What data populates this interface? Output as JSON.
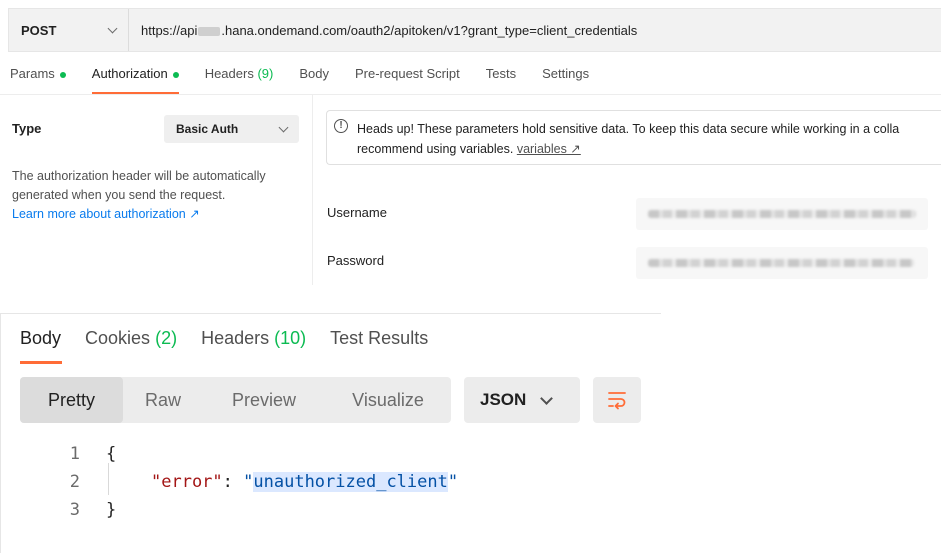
{
  "request": {
    "method": "POST",
    "url_prefix": "https://api",
    "url_suffix": ".hana.ondemand.com/oauth2/apitoken/v1?grant_type=client_credentials"
  },
  "request_tabs": [
    {
      "label": "Params",
      "indicator": "dot",
      "active": false
    },
    {
      "label": "Authorization",
      "indicator": "dot",
      "active": true
    },
    {
      "label": "Headers",
      "count": "(9)",
      "active": false
    },
    {
      "label": "Body",
      "active": false
    },
    {
      "label": "Pre-request Script",
      "active": false
    },
    {
      "label": "Tests",
      "active": false
    },
    {
      "label": "Settings",
      "active": false
    }
  ],
  "auth": {
    "type_label": "Type",
    "type_value": "Basic Auth",
    "description": "The authorization header will be automatically generated when you send the request.",
    "learn_more": "Learn more about authorization ↗",
    "notice_icon": "info-icon",
    "notice_text": "Heads up! These parameters hold sensitive data. To keep this data secure while working in a colla",
    "notice_text_2": "recommend using variables.",
    "notice_link": "variables ↗",
    "username_label": "Username",
    "password_label": "Password"
  },
  "response": {
    "tabs": [
      {
        "label": "Body",
        "active": true
      },
      {
        "label": "Cookies",
        "count": "(2)"
      },
      {
        "label": "Headers",
        "count": "(10)"
      },
      {
        "label": "Test Results"
      }
    ],
    "formats": [
      "Pretty",
      "Raw",
      "Preview",
      "Visualize"
    ],
    "active_format": "Pretty",
    "language": "JSON",
    "wrap_icon": "wrap-lines-icon",
    "code_lines": [
      {
        "num": "1",
        "text": "{"
      },
      {
        "num": "2",
        "key": "\"error\"",
        "colon": ": ",
        "value": "\"unauthorized_client\""
      },
      {
        "num": "3",
        "text": "}"
      }
    ]
  },
  "colors": {
    "accent": "#ff6c37",
    "indicator": "#0cbb52",
    "link": "#097bed",
    "json_key": "#a31515",
    "json_string": "#0451a5"
  }
}
